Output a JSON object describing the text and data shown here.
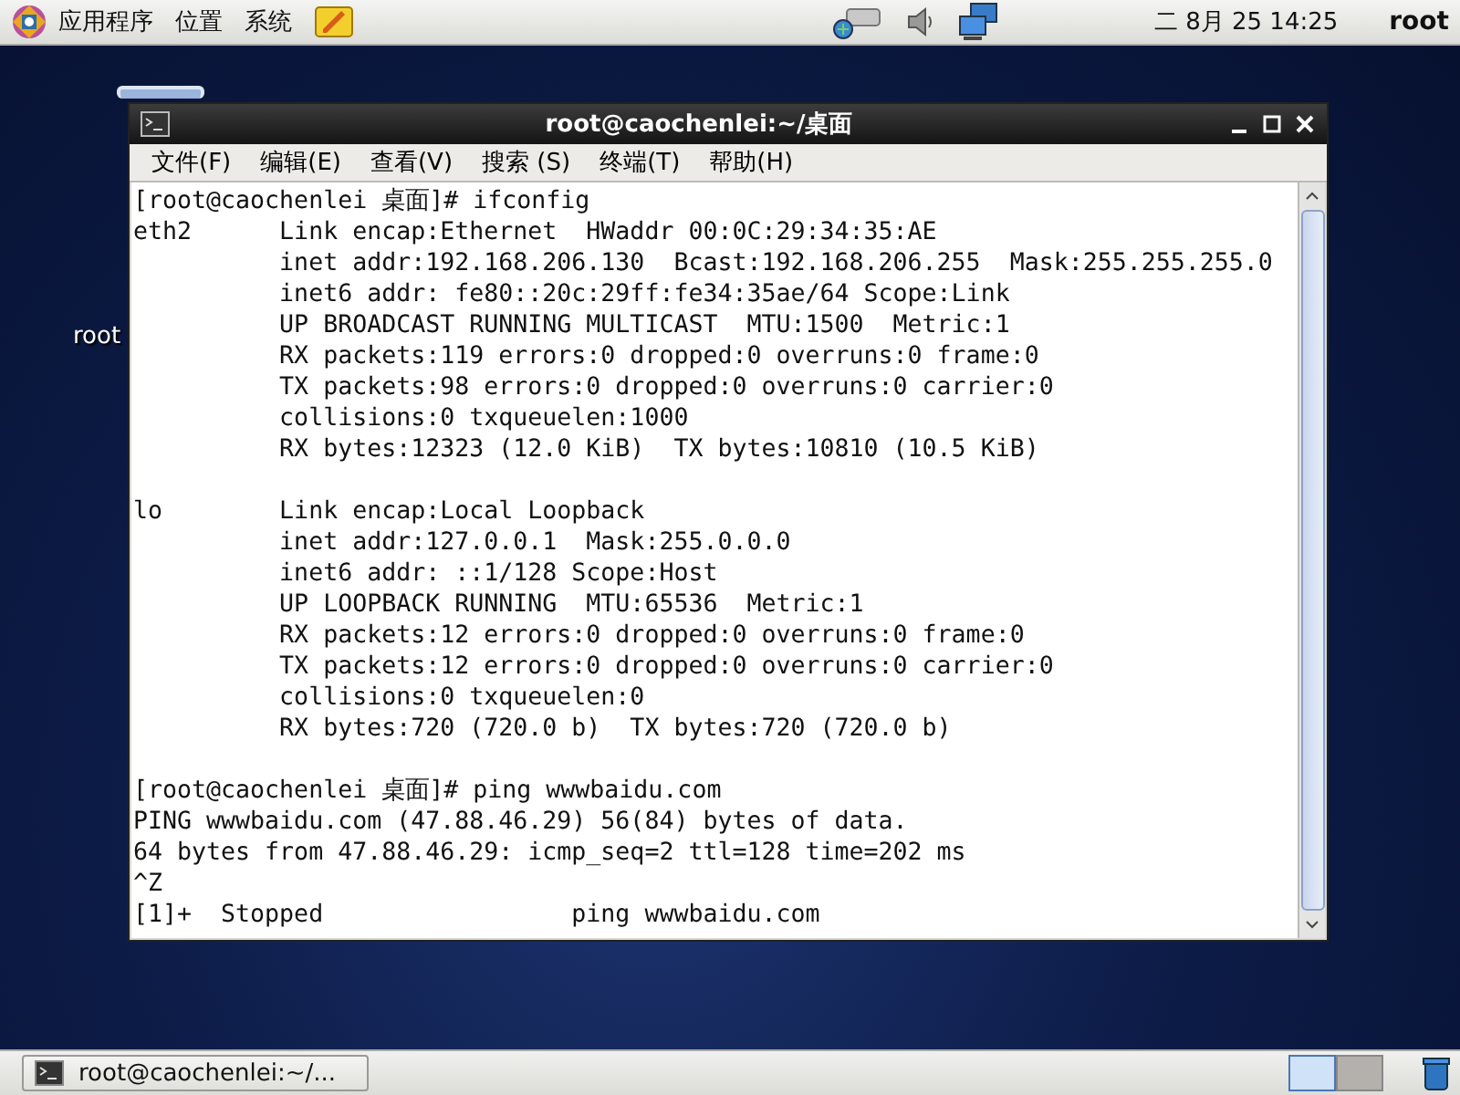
{
  "top_panel": {
    "menus": [
      "应用程序",
      "位置",
      "系统"
    ],
    "clock": "二 8月 25 14:25",
    "user": "root"
  },
  "desktop": {
    "icon_label": "root"
  },
  "window": {
    "title": "root@caochenlei:~/桌面",
    "menu": [
      "文件(F)",
      "编辑(E)",
      "查看(V)",
      "搜索 (S)",
      "终端(T)",
      "帮助(H)"
    ],
    "blocks": [
      [
        "[root@caochenlei 桌面]# ifconfig",
        "eth2      Link encap:Ethernet  HWaddr 00:0C:29:34:35:AE",
        "          inet addr:192.168.206.130  Bcast:192.168.206.255  Mask:255.255.255.0",
        "          inet6 addr: fe80::20c:29ff:fe34:35ae/64 Scope:Link",
        "          UP BROADCAST RUNNING MULTICAST  MTU:1500  Metric:1",
        "          RX packets:119 errors:0 dropped:0 overruns:0 frame:0",
        "          TX packets:98 errors:0 dropped:0 overruns:0 carrier:0",
        "          collisions:0 txqueuelen:1000",
        "          RX bytes:12323 (12.0 KiB)  TX bytes:10810 (10.5 KiB)"
      ],
      [
        "lo        Link encap:Local Loopback",
        "          inet addr:127.0.0.1  Mask:255.0.0.0",
        "          inet6 addr: ::1/128 Scope:Host",
        "          UP LOOPBACK RUNNING  MTU:65536  Metric:1",
        "          RX packets:12 errors:0 dropped:0 overruns:0 frame:0",
        "          TX packets:12 errors:0 dropped:0 overruns:0 carrier:0",
        "          collisions:0 txqueuelen:0",
        "          RX bytes:720 (720.0 b)  TX bytes:720 (720.0 b)"
      ],
      [
        "[root@caochenlei 桌面]# ping wwwbaidu.com",
        "PING wwwbaidu.com (47.88.46.29) 56(84) bytes of data.",
        "64 bytes from 47.88.46.29: icmp_seq=2 ttl=128 time=202 ms",
        "^Z",
        "[1]+  Stopped                 ping wwwbaidu.com"
      ]
    ]
  },
  "taskbar": {
    "tasks": [
      {
        "label": "root@caochenlei:~/..."
      }
    ],
    "workspaces": [
      {
        "selected": true
      },
      {
        "selected": false
      }
    ]
  }
}
